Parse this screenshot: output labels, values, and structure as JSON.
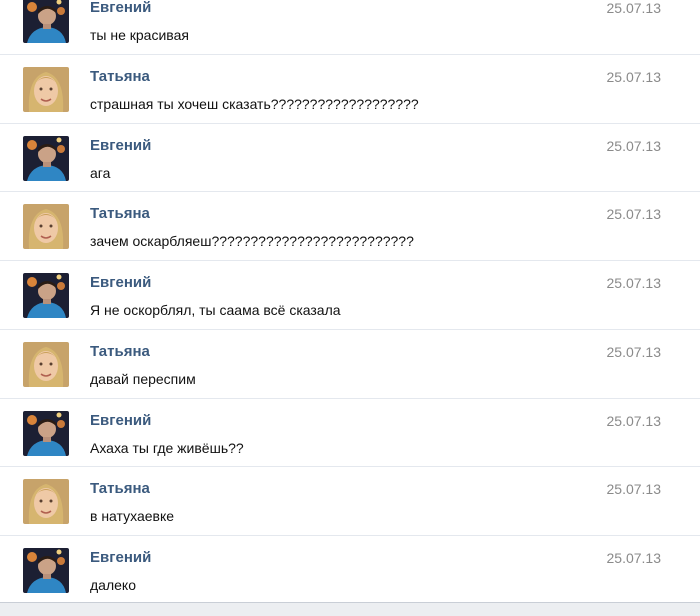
{
  "messages": [
    {
      "author": "Евгений",
      "text": "ты не красивая",
      "date": "25.07.13",
      "avatar": "evgeny"
    },
    {
      "author": "Татьяна",
      "text": "страшная ты хочеш сказать???????????????????",
      "date": "25.07.13",
      "avatar": "tatyana"
    },
    {
      "author": "Евгений",
      "text": "ага",
      "date": "25.07.13",
      "avatar": "evgeny"
    },
    {
      "author": "Татьяна",
      "text": "зачем оскарбляеш??????????????????????????",
      "date": "25.07.13",
      "avatar": "tatyana"
    },
    {
      "author": "Евгений",
      "text": "Я не оскорблял, ты саама всё сказала",
      "date": "25.07.13",
      "avatar": "evgeny"
    },
    {
      "author": "Татьяна",
      "text": "давай переспим",
      "date": "25.07.13",
      "avatar": "tatyana"
    },
    {
      "author": "Евгений",
      "text": "Ахаха ты где живёшь??",
      "date": "25.07.13",
      "avatar": "evgeny"
    },
    {
      "author": "Татьяна",
      "text": "в натухаевке",
      "date": "25.07.13",
      "avatar": "tatyana"
    },
    {
      "author": "Евгений",
      "text": "далеко",
      "date": "25.07.13",
      "avatar": "evgeny"
    }
  ],
  "colors": {
    "author": "#3b5a7e",
    "text": "#111111",
    "date": "#8a8a8a",
    "divider": "#e4e8ee"
  }
}
